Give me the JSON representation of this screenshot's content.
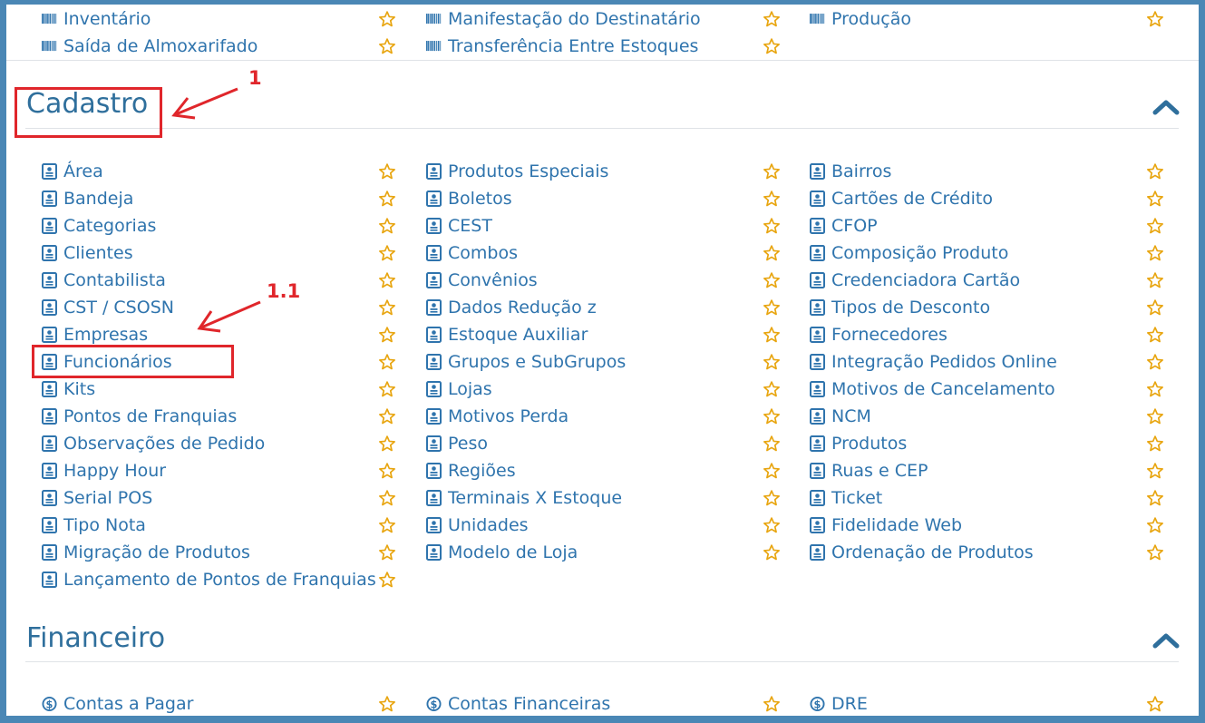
{
  "colors": {
    "frame": "#4a87b5",
    "link": "#2f74ad",
    "section": "#2f6f9c",
    "star": "#e8a50f",
    "annotation": "#e0262b"
  },
  "top_group": {
    "icon": "barcode-icon",
    "columns": [
      [
        "Inventário",
        "Saída de Almoxarifado"
      ],
      [
        "Manifestação do Destinatário",
        "Transferência Entre Estoques"
      ],
      [
        "Produção"
      ]
    ]
  },
  "cadastro": {
    "title": "Cadastro",
    "icon": "contact-card-icon",
    "columns": [
      [
        "Área",
        "Bandeja",
        "Categorias",
        "Clientes",
        "Contabilista",
        "CST / CSOSN",
        "Empresas",
        "Funcionários",
        "Kits",
        "Pontos de Franquias",
        "Observações de Pedido",
        "Happy Hour",
        "Serial POS",
        "Tipo Nota",
        "Migração de Produtos",
        "Lançamento de Pontos de Franquias"
      ],
      [
        "Produtos Especiais",
        "Boletos",
        "CEST",
        "Combos",
        "Convênios",
        "Dados Redução z",
        "Estoque Auxiliar",
        "Grupos e SubGrupos",
        "Lojas",
        "Motivos Perda",
        "Peso",
        "Regiões",
        "Terminais X Estoque",
        "Unidades",
        "Modelo de Loja"
      ],
      [
        "Bairros",
        "Cartões de Crédito",
        "CFOP",
        "Composição Produto",
        "Credenciadora Cartão",
        "Tipos de Desconto",
        "Fornecedores",
        "Integração Pedidos Online",
        "Motivos de Cancelamento",
        "NCM",
        "Produtos",
        "Ruas e CEP",
        "Ticket",
        "Fidelidade Web",
        "Ordenação de Produtos"
      ]
    ]
  },
  "financeiro": {
    "title": "Financeiro",
    "icon": "dollar-circle-icon",
    "columns": [
      [
        "Contas a Pagar"
      ],
      [
        "Contas Financeiras"
      ],
      [
        "DRE"
      ]
    ]
  },
  "annotations": {
    "step_1": "1",
    "step_1_1": "1.1"
  }
}
